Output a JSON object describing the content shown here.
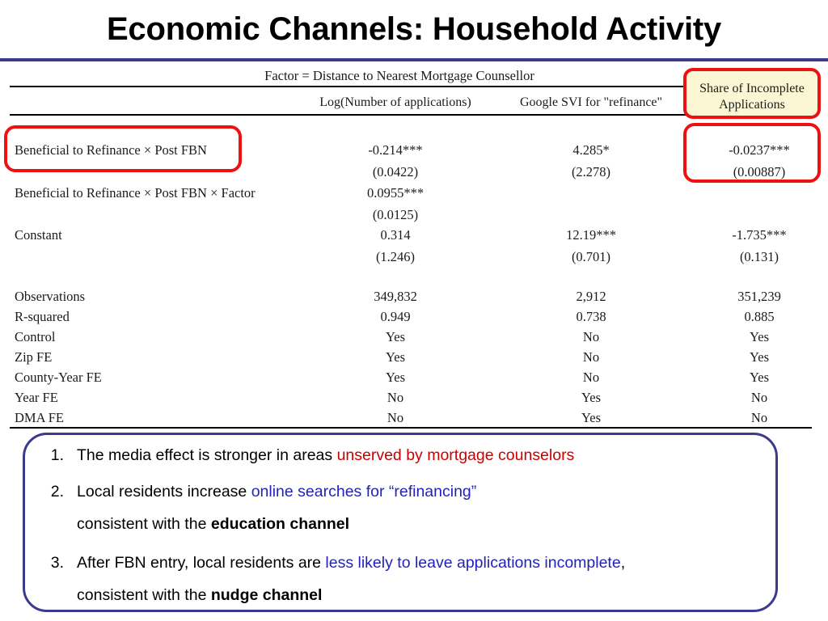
{
  "slide": {
    "title": "Economic Channels: Household Activity",
    "divider_color": "#3b3a8c"
  },
  "table": {
    "factor_note": "Factor = Distance to Nearest Mortgage Counsellor",
    "column_headers": [
      "Log(Number of applications)",
      "Google SVI for \"refinance\"",
      "Share of Incomplete Applications"
    ],
    "column_header_3_line1": "Share of Incomplete",
    "column_header_3_line2": "Applications",
    "rows": [
      {
        "label": "Beneficial to Refinance × Post FBN",
        "coef": [
          "-0.214***",
          "4.285*",
          "-0.0237***"
        ],
        "se": [
          "(0.0422)",
          "(2.278)",
          "(0.00887)"
        ]
      },
      {
        "label": "Beneficial to Refinance × Post FBN × Factor",
        "coef": [
          "0.0955***",
          "",
          ""
        ],
        "se": [
          "(0.0125)",
          "",
          ""
        ]
      },
      {
        "label": "Constant",
        "coef": [
          "0.314",
          "12.19***",
          "-1.735***"
        ],
        "se": [
          "(1.246)",
          "(0.701)",
          "(0.131)"
        ]
      }
    ],
    "stats": [
      {
        "label": "Observations",
        "values": [
          "349,832",
          "2,912",
          "351,239"
        ]
      },
      {
        "label": "R-squared",
        "values": [
          "0.949",
          "0.738",
          "0.885"
        ]
      },
      {
        "label": "Control",
        "values": [
          "Yes",
          "No",
          "Yes"
        ]
      },
      {
        "label": "Zip FE",
        "values": [
          "Yes",
          "No",
          "Yes"
        ]
      },
      {
        "label": "County-Year FE",
        "values": [
          "Yes",
          "No",
          "Yes"
        ]
      },
      {
        "label": "Year FE",
        "values": [
          "No",
          "Yes",
          "No"
        ]
      },
      {
        "label": "DMA FE",
        "values": [
          "No",
          "Yes",
          "No"
        ]
      }
    ],
    "highlight_color": "#ee1111",
    "highlight_fill": "#fbf7d5"
  },
  "conclusion": {
    "border_color": "#3b3a8c",
    "bullets": [
      {
        "num": "1.",
        "parts": [
          {
            "text": "The media effect is stronger in areas ",
            "style": "plain"
          },
          {
            "text": "unserved by mortgage counselors",
            "style": "red"
          }
        ]
      },
      {
        "num": "2.",
        "parts": [
          {
            "text": "Local residents increase ",
            "style": "plain"
          },
          {
            "text": "online searches for “refinancing”",
            "style": "blue"
          }
        ]
      },
      {
        "num": "",
        "parts": [
          {
            "text": "consistent with the ",
            "style": "plain"
          },
          {
            "text": "education channel",
            "style": "bold"
          }
        ]
      },
      {
        "num": "3.",
        "parts": [
          {
            "text": "After FBN entry, local residents are ",
            "style": "plain"
          },
          {
            "text": "less likely to leave applications incomplete",
            "style": "blue"
          },
          {
            "text": ",",
            "style": "plain"
          }
        ]
      },
      {
        "num": "",
        "parts": [
          {
            "text": "consistent with the ",
            "style": "plain"
          },
          {
            "text": "nudge channel",
            "style": "bold"
          }
        ]
      }
    ],
    "b1_text_plain": "The media effect is stronger in areas ",
    "b1_text_red": "unserved by mortgage counselors",
    "b2_text_plain": "Local residents increase ",
    "b2_text_blue": "online searches for “refinancing”",
    "b2b_text_plain": "consistent with the ",
    "b2b_text_bold": "education channel",
    "b3_text_plain": "After FBN entry, local residents are ",
    "b3_text_blue": "less likely to leave applications incomplete",
    "b3_text_tail": ",",
    "b3b_text_plain": "consistent with the ",
    "b3b_text_bold": "nudge channel",
    "num1": "1.",
    "num2": "2.",
    "num3": "3."
  }
}
